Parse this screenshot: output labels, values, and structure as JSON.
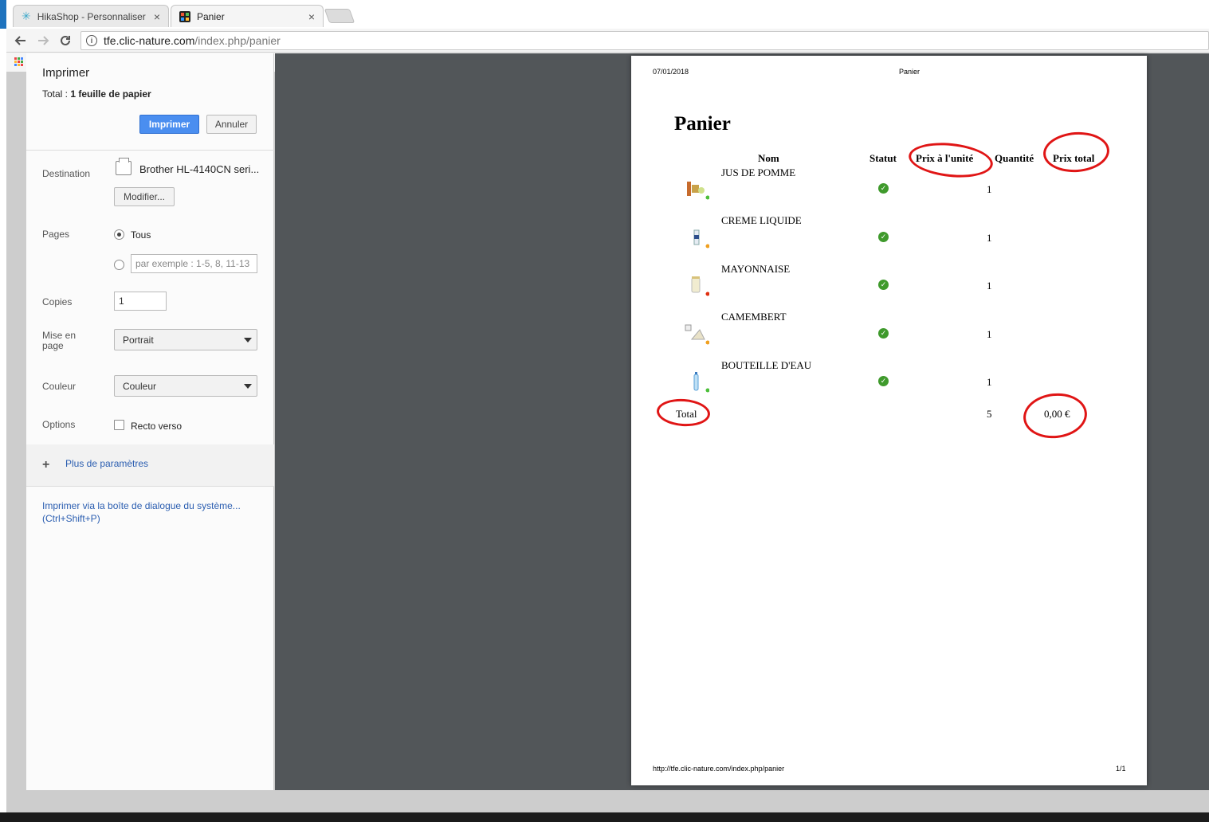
{
  "browser": {
    "tabs": [
      {
        "title": "HikaShop - Personnaliser",
        "close": "×"
      },
      {
        "title": "Panier",
        "close": "×"
      }
    ],
    "url_host": "tfe.clic-nature.com",
    "url_path": "/index.php/panier",
    "info_icon_glyph": "i"
  },
  "print_dialog": {
    "title": "Imprimer",
    "total_prefix": "Total : ",
    "total_value": "1 feuille de papier",
    "print_button": "Imprimer",
    "cancel_button": "Annuler",
    "destination_label": "Destination",
    "destination_value": "Brother HL-4140CN seri...",
    "modify_button": "Modifier...",
    "pages_label": "Pages",
    "pages_all": "Tous",
    "pages_placeholder": "par exemple : 1-5, 8, 11-13",
    "copies_label": "Copies",
    "copies_value": "1",
    "layout_label": "Mise en page",
    "layout_value": "Portrait",
    "color_label": "Couleur",
    "color_value": "Couleur",
    "options_label": "Options",
    "duplex_label": "Recto verso",
    "more_settings": "Plus de paramètres",
    "system_dialog_line1": "Imprimer via la boîte de dialogue du système...",
    "system_dialog_line2": "(Ctrl+Shift+P)"
  },
  "document": {
    "header_date": "07/01/2018",
    "header_title": "Panier",
    "title": "Panier",
    "columns": {
      "name": "Nom",
      "status": "Statut",
      "unit_price": "Prix à l'unité",
      "quantity": "Quantité",
      "total_price": "Prix total"
    },
    "items": [
      {
        "name": "JUS DE POMME",
        "quantity": "1",
        "status_icon": "check-icon"
      },
      {
        "name": "CREME LIQUIDE",
        "quantity": "1",
        "status_icon": "check-icon"
      },
      {
        "name": "MAYONNAISE",
        "quantity": "1",
        "status_icon": "check-icon"
      },
      {
        "name": "CAMEMBERT",
        "quantity": "1",
        "status_icon": "check-icon"
      },
      {
        "name": "BOUTEILLE D'EAU",
        "quantity": "1",
        "status_icon": "check-icon"
      }
    ],
    "total_label": "Total",
    "total_quantity": "5",
    "total_price": "0,00 €",
    "footer_url": "http://tfe.clic-nature.com/index.php/panier",
    "footer_page": "1/1"
  },
  "colors": {
    "print_button": "#4a8ef0",
    "status_check": "#3f9a2c",
    "annotation": "#e01515",
    "preview_background": "#525659"
  }
}
